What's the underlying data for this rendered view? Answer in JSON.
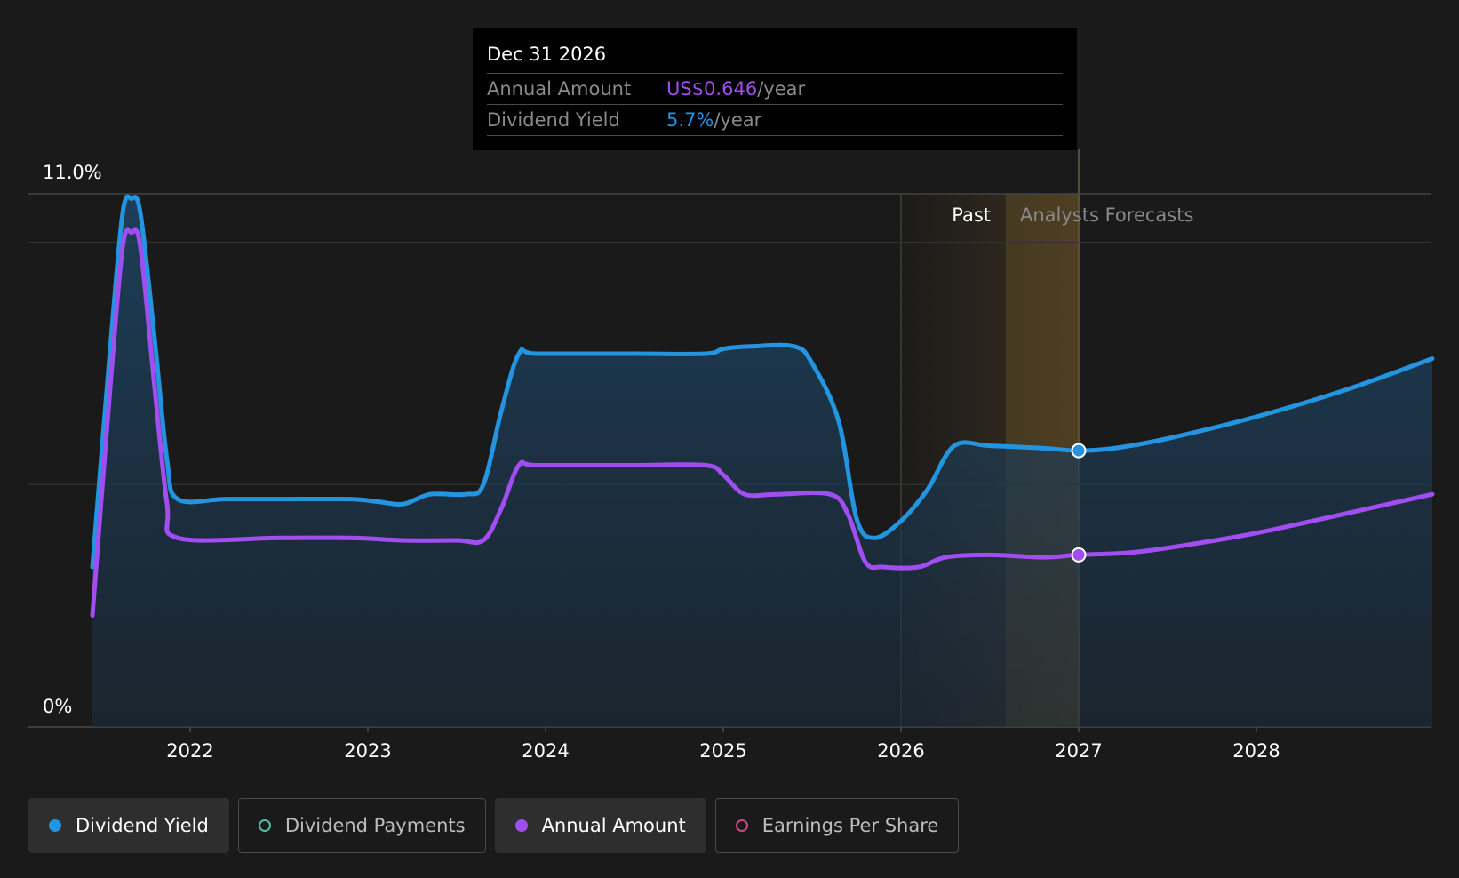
{
  "tooltip": {
    "date": "Dec 31 2026",
    "annual_label": "Annual Amount",
    "annual_value": "US$0.646",
    "annual_unit": "/year",
    "yield_label": "Dividend Yield",
    "yield_value": "5.7%",
    "yield_unit": "/year"
  },
  "region_labels": {
    "past": "Past",
    "forecast": "Analysts Forecasts"
  },
  "legend": [
    {
      "label": "Dividend Yield",
      "color": "#2394df",
      "active": true,
      "filled": true
    },
    {
      "label": "Dividend Payments",
      "color": "#4fbfa8",
      "active": false,
      "filled": false
    },
    {
      "label": "Annual Amount",
      "color": "#a04ef0",
      "active": true,
      "filled": true
    },
    {
      "label": "Earnings Per Share",
      "color": "#c94a86",
      "active": false,
      "filled": false
    }
  ],
  "colors": {
    "yield": "#2394df",
    "annual": "#a04ef0",
    "background": "#1a1a1a"
  },
  "chart_data": {
    "type": "area",
    "x_ticks": [
      "2022",
      "2023",
      "2024",
      "2025",
      "2026",
      "2027",
      "2028"
    ],
    "y_tick_labels": [
      "11.0%",
      "0%"
    ],
    "ylim": [
      0,
      11.0
    ],
    "xlim": [
      2021.42,
      2028.99
    ],
    "grid": true,
    "past_end": 2026.0,
    "highlight_date": 2027.0,
    "series": [
      {
        "name": "Dividend Yield",
        "unit": "%",
        "points": [
          [
            2021.45,
            3.3
          ],
          [
            2021.55,
            7.8
          ],
          [
            2021.62,
            10.6
          ],
          [
            2021.67,
            10.9
          ],
          [
            2021.72,
            10.6
          ],
          [
            2021.8,
            8.0
          ],
          [
            2021.87,
            5.5
          ],
          [
            2021.93,
            4.7
          ],
          [
            2022.2,
            4.7
          ],
          [
            2022.5,
            4.7
          ],
          [
            2022.9,
            4.7
          ],
          [
            2023.05,
            4.65
          ],
          [
            2023.2,
            4.6
          ],
          [
            2023.35,
            4.8
          ],
          [
            2023.55,
            4.8
          ],
          [
            2023.65,
            5.0
          ],
          [
            2023.75,
            6.5
          ],
          [
            2023.85,
            7.7
          ],
          [
            2023.95,
            7.7
          ],
          [
            2024.5,
            7.7
          ],
          [
            2024.9,
            7.7
          ],
          [
            2025.0,
            7.8
          ],
          [
            2025.15,
            7.85
          ],
          [
            2025.4,
            7.85
          ],
          [
            2025.5,
            7.5
          ],
          [
            2025.65,
            6.3
          ],
          [
            2025.75,
            4.3
          ],
          [
            2025.85,
            3.9
          ],
          [
            2026.0,
            4.25
          ],
          [
            2026.15,
            4.9
          ],
          [
            2026.3,
            5.8
          ],
          [
            2026.5,
            5.8
          ],
          [
            2026.8,
            5.75
          ],
          [
            2027.0,
            5.7
          ],
          [
            2027.2,
            5.75
          ],
          [
            2027.5,
            5.95
          ],
          [
            2028.0,
            6.4
          ],
          [
            2028.5,
            6.95
          ],
          [
            2028.99,
            7.6
          ]
        ]
      },
      {
        "name": "Annual Amount",
        "unit": "US$",
        "points": [
          [
            2021.45,
            2.3
          ],
          [
            2021.55,
            7.0
          ],
          [
            2021.62,
            9.9
          ],
          [
            2021.67,
            10.2
          ],
          [
            2021.72,
            9.9
          ],
          [
            2021.8,
            7.0
          ],
          [
            2021.87,
            4.6
          ],
          [
            2021.93,
            3.9
          ],
          [
            2022.5,
            3.9
          ],
          [
            2022.9,
            3.9
          ],
          [
            2023.2,
            3.85
          ],
          [
            2023.5,
            3.85
          ],
          [
            2023.65,
            3.85
          ],
          [
            2023.75,
            4.5
          ],
          [
            2023.85,
            5.4
          ],
          [
            2023.95,
            5.4
          ],
          [
            2024.5,
            5.4
          ],
          [
            2024.9,
            5.4
          ],
          [
            2025.0,
            5.2
          ],
          [
            2025.12,
            4.8
          ],
          [
            2025.3,
            4.8
          ],
          [
            2025.6,
            4.8
          ],
          [
            2025.7,
            4.4
          ],
          [
            2025.8,
            3.4
          ],
          [
            2025.9,
            3.3
          ],
          [
            2026.1,
            3.3
          ],
          [
            2026.25,
            3.5
          ],
          [
            2026.5,
            3.55
          ],
          [
            2026.8,
            3.5
          ],
          [
            2027.0,
            3.55
          ],
          [
            2027.3,
            3.6
          ],
          [
            2027.6,
            3.75
          ],
          [
            2028.0,
            4.0
          ],
          [
            2028.5,
            4.4
          ],
          [
            2028.99,
            4.8
          ]
        ]
      }
    ]
  }
}
